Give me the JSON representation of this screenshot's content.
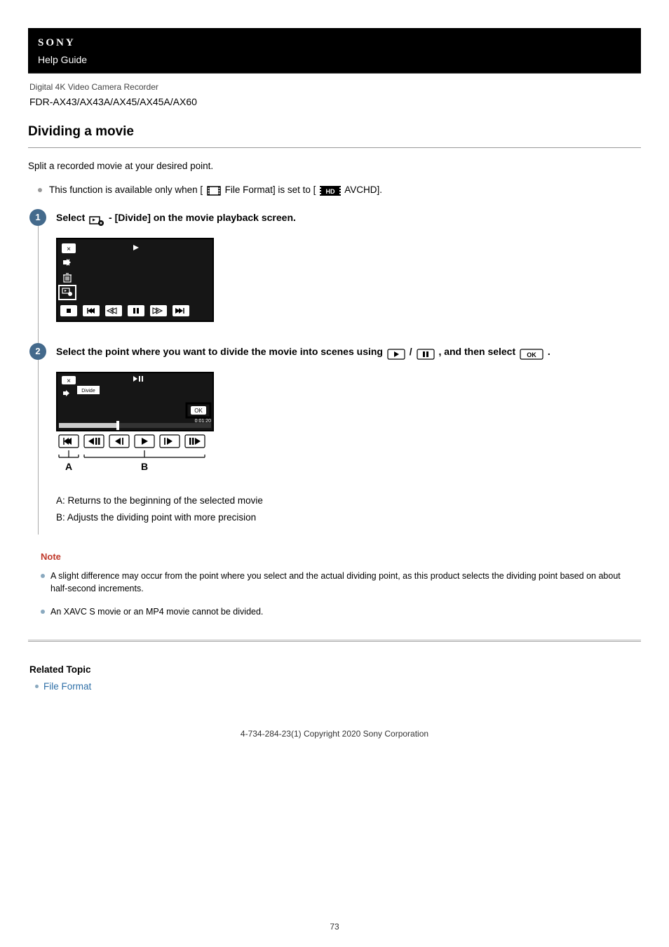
{
  "header": {
    "brand": "SONY",
    "guide": "Help Guide",
    "product_line": "Digital 4K Video Camera Recorder",
    "product_family": "FDR-AX43/AX43A/AX45/AX45A/AX60"
  },
  "title": "Dividing a movie",
  "intro": "Split a recorded movie at your desired point.",
  "bullet_prefix": "This function is available only when [",
  "bullet_mid": "File Format] is set to [",
  "bullet_suffix": "AVCHD].",
  "steps": {
    "s1": {
      "num": "1",
      "title_prefix": "Select ",
      "title_suffix": " - [Divide] on the movie playback screen."
    },
    "s2": {
      "num": "2",
      "title_prefix": "Select the point where you want to divide the movie into scenes using ",
      "title_mid": " / ",
      "title_mid2": " , and then select ",
      "title_suffix": " .",
      "desc_a": "A: Returns to the beginning of the selected movie",
      "desc_b": "B: Adjusts the dividing point with more precision",
      "label_a": "A",
      "label_b": "B",
      "divide_label": "Divide",
      "ok_label": "OK",
      "time_label": "0:01:20"
    }
  },
  "note": {
    "title": "Note",
    "items": [
      "A slight difference may occur from the point where you select and the actual dividing point, as this product selects the dividing point based on about half-second increments.",
      "An XAVC S movie or an MP4 movie cannot be divided."
    ]
  },
  "related": {
    "title": "Related Topic",
    "items": [
      "File Format"
    ]
  },
  "copyright": "4-734-284-23(1) Copyright 2020 Sony Corporation",
  "page_number": "73"
}
